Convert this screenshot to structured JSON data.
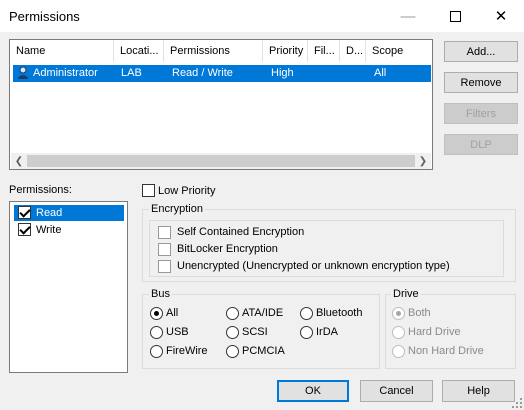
{
  "window": {
    "title": "Permissions"
  },
  "list": {
    "columns": [
      "Name",
      "Locati...",
      "Permissions",
      "Priority",
      "Fil...",
      "D...",
      "Scope"
    ],
    "rows": [
      {
        "name": "Administrator",
        "location": "LAB",
        "permissions": "Read / Write",
        "priority": "High",
        "filter": "",
        "dlp": "",
        "scope": "All"
      }
    ]
  },
  "side_buttons": {
    "add": "Add...",
    "remove": "Remove",
    "filters": "Filters",
    "dlp": "DLP"
  },
  "permissions_panel": {
    "label": "Permissions:",
    "items": [
      {
        "label": "Read",
        "checked": true,
        "selected": true
      },
      {
        "label": "Write",
        "checked": true,
        "selected": false
      }
    ]
  },
  "low_priority": {
    "label": "Low Priority",
    "checked": false
  },
  "encryption": {
    "title": "Encryption",
    "options": [
      {
        "label": "Self Contained Encryption",
        "checked": false
      },
      {
        "label": "BitLocker Encryption",
        "checked": false
      },
      {
        "label": "Unencrypted (Unencrypted or unknown encryption type)",
        "checked": false
      }
    ]
  },
  "bus": {
    "title": "Bus",
    "options": [
      "All",
      "ATA/IDE",
      "Bluetooth",
      "USB",
      "SCSI",
      "IrDA",
      "FireWire",
      "PCMCIA"
    ],
    "selected": "All"
  },
  "drive": {
    "title": "Drive",
    "options": [
      "Both",
      "Hard Drive",
      "Non Hard Drive"
    ],
    "selected": "Both",
    "enabled": false
  },
  "footer": {
    "ok": "OK",
    "cancel": "Cancel",
    "help": "Help"
  },
  "colors": {
    "selection": "#0078d7",
    "selection_inactive": "#cce8ff",
    "background": "#f0f0f0"
  }
}
